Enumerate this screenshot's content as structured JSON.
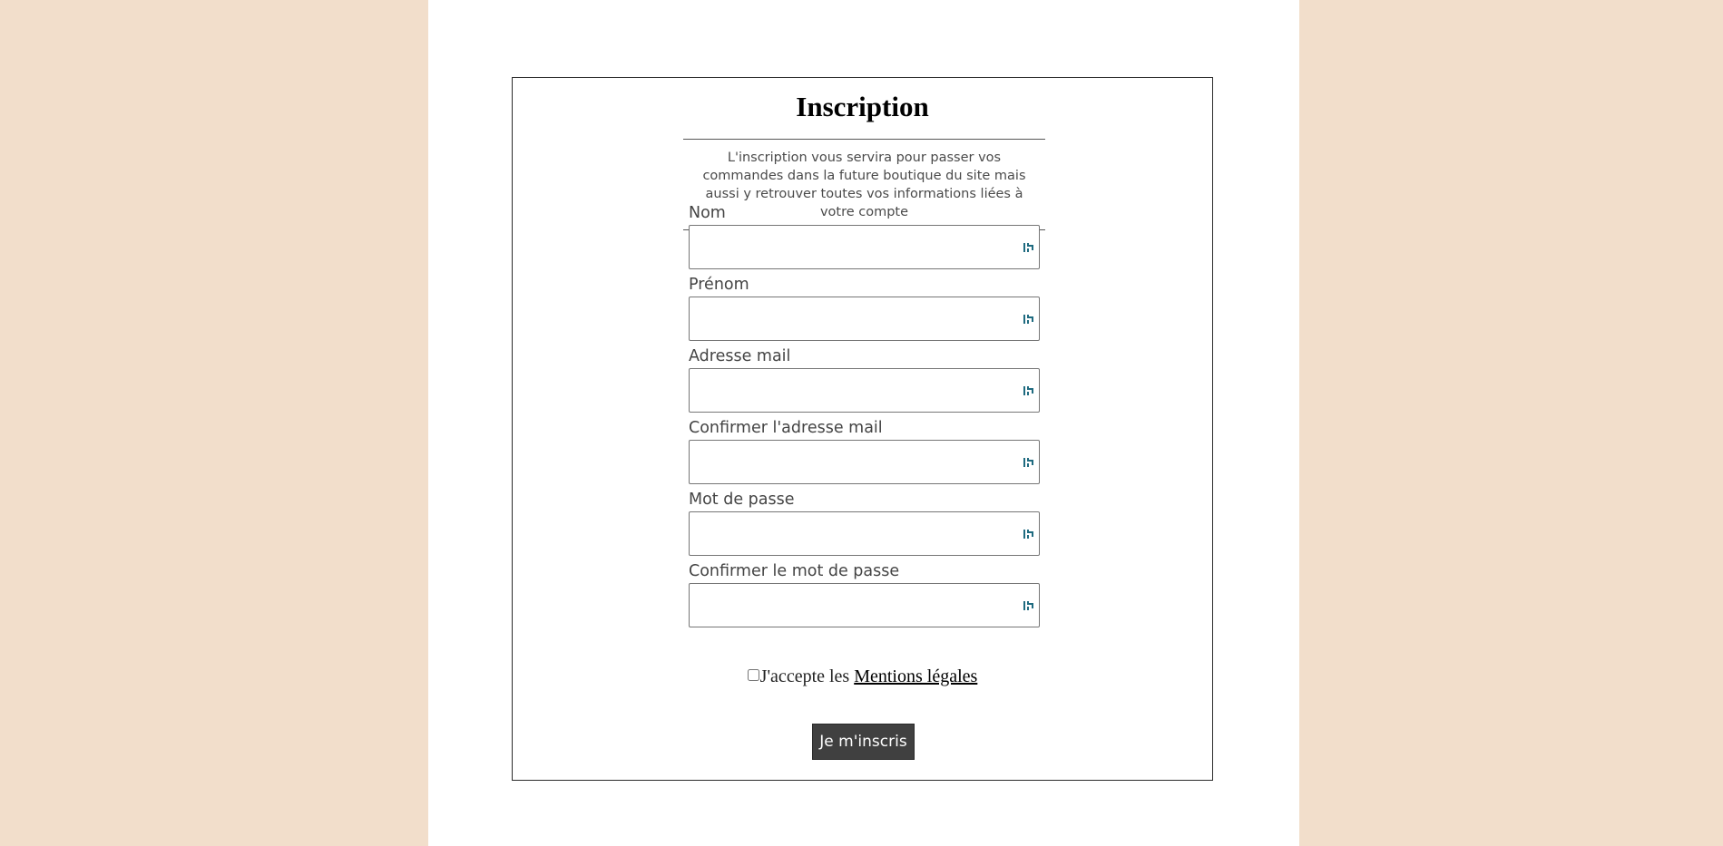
{
  "form": {
    "title": "Inscription",
    "intro": "L'inscription vous servira pour passer vos commandes dans la future boutique du site mais aussi y retrouver toutes vos informations liées à votre compte",
    "fields": [
      {
        "label": "Nom",
        "value": "",
        "icon": "password-manager-key-icon"
      },
      {
        "label": "Prénom",
        "value": "",
        "icon": "password-manager-key-icon"
      },
      {
        "label": "Adresse mail",
        "value": "",
        "icon": "password-manager-key-icon"
      },
      {
        "label": "Confirmer l'adresse mail",
        "value": "",
        "icon": "password-manager-key-icon"
      },
      {
        "label": "Mot de passe",
        "value": "",
        "icon": "password-manager-key-icon"
      },
      {
        "label": "Confirmer le mot de passe",
        "value": "",
        "icon": "password-manager-key-icon"
      }
    ],
    "terms_prefix": "J'accepte les ",
    "terms_link": "Mentions légales",
    "terms_checked": false,
    "submit_label": "Je m'inscris"
  },
  "colors": {
    "background": "#f2decb",
    "page": "#ffffff",
    "border": "#2b2b2b",
    "button": "#404040",
    "icon_accent": "#1f6b80"
  }
}
